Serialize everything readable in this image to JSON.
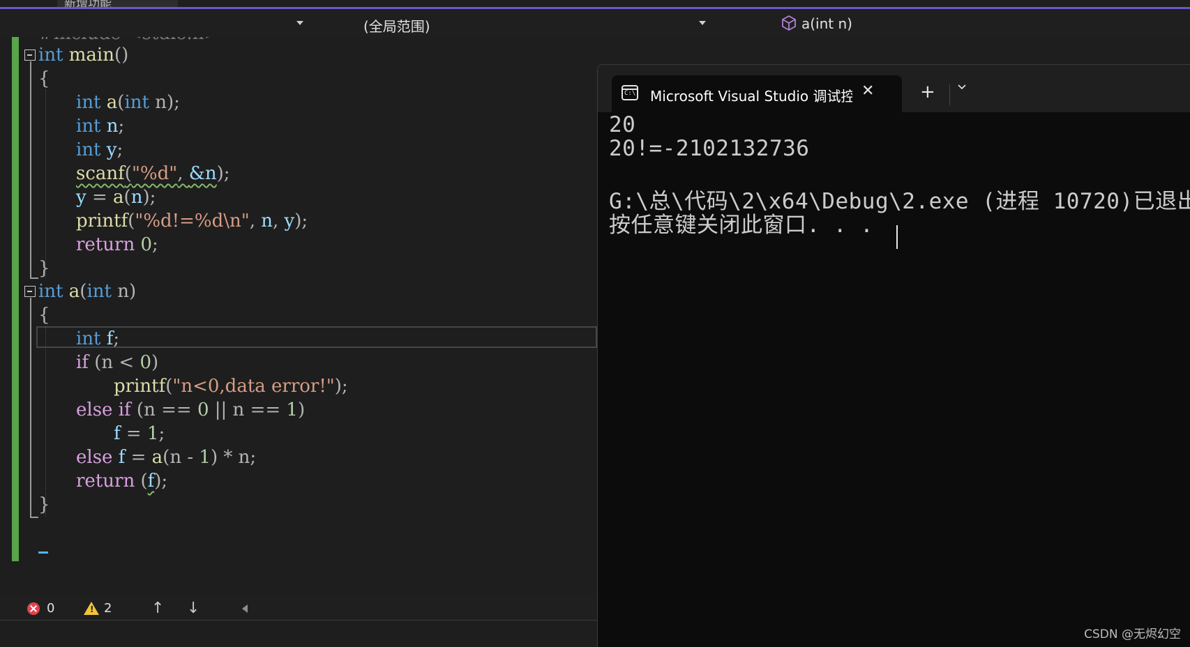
{
  "top_tab": {
    "label": "新增功能"
  },
  "navbar": {
    "project_dropdown": "",
    "scope_dropdown": "(全局范围)",
    "member_dropdown": "a(int n)",
    "member_icon": "cube-icon"
  },
  "editor": {
    "lines": [
      "#include <stdio.h>",
      "int main()",
      "{",
      "int a(int n);",
      "int n;",
      "int y;",
      "scanf(\"%d\", &n);",
      "y = a(n);",
      "printf(\"%d!=%d\\n\", n, y);",
      "return 0;",
      "}",
      "int a(int n)",
      "{",
      "int f;",
      "if (n < 0)",
      "printf(\"n<0,data error!\");",
      "else if (n == 0 || n == 1)",
      "f = 1;",
      "else f = a(n - 1) * n;",
      "return (f);",
      "}"
    ],
    "tokens": {
      "include_line": "#include <stdio.h>",
      "int": "int",
      "main": "main",
      "a": "a",
      "n": "n",
      "y": "y",
      "f": "f",
      "scanf": "scanf",
      "printf": "printf",
      "return": "return",
      "if": "if",
      "else": "else",
      "fmt1": "\"%d\"",
      "amp_n": "&n",
      "fmt2": "\"%d!=%d\\n\"",
      "fmt3": "\"n<0,data error!\"",
      "zero": "0",
      "one": "1"
    }
  },
  "statusbar": {
    "error_count": "0",
    "warning_count": "2",
    "up_arrow": "↑",
    "down_arrow": "↓"
  },
  "terminal": {
    "tab_title": "Microsoft Visual Studio 调试控制台",
    "close_glyph": "✕",
    "new_tab_glyph": "+",
    "output_lines": [
      "20",
      "20!=-2102132736",
      "",
      "G:\\总\\代码\\2\\x64\\Debug\\2.exe (进程 10720)已退出",
      "按任意键关闭此窗口. . ."
    ]
  },
  "watermark": "CSDN @无烬幻空"
}
